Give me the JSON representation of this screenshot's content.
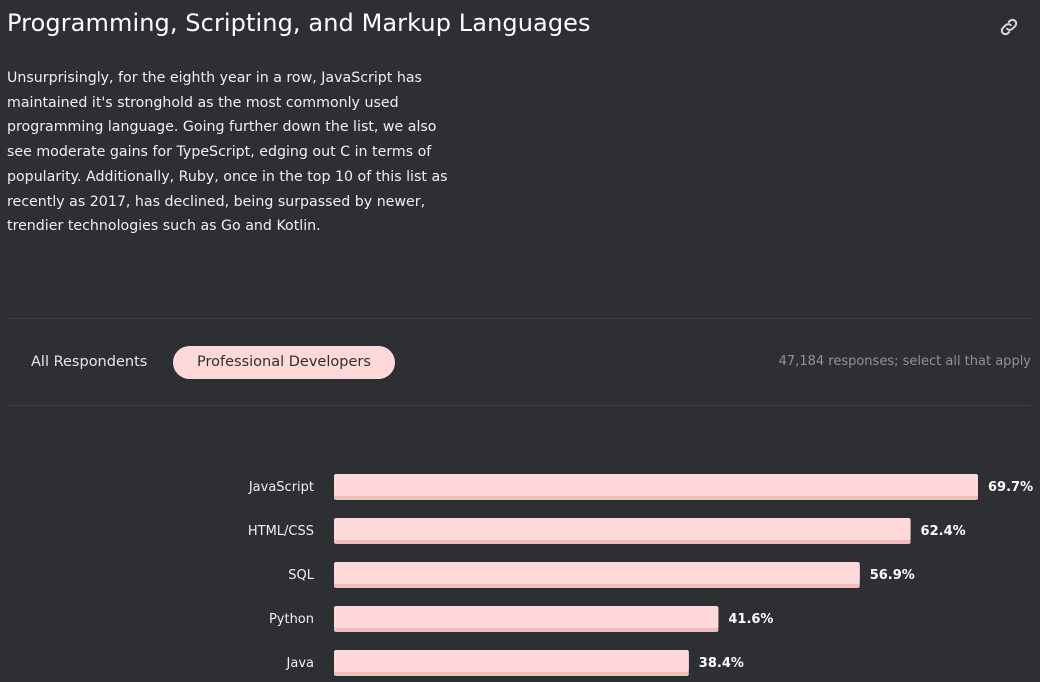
{
  "header": {
    "title": "Programming, Scripting, and Markup Languages",
    "link_icon": "link-icon"
  },
  "intro": "Unsurprisingly, for the eighth year in a row, JavaScript has maintained it's stronghold as the most commonly used programming language. Going further down the list, we also see moderate gains for TypeScript, edging out C in terms of popularity. Additionally, Ruby, once in the top 10 of this list as recently as 2017, has declined, being surpassed by newer, trendier technologies such as Go and Kotlin.",
  "tabs": [
    {
      "label": "All Respondents",
      "active": false
    },
    {
      "label": "Professional Developers",
      "active": true
    }
  ],
  "responses_note": "47,184 responses; select all that apply",
  "colors": {
    "background": "#2d2f33",
    "bar": "#ffd9d9",
    "bar_shadow": "#f3bcbc",
    "active_tab": "#ffd9d9"
  },
  "chart_data": {
    "type": "bar",
    "orientation": "horizontal",
    "categories": [
      "JavaScript",
      "HTML/CSS",
      "SQL",
      "Python",
      "Java"
    ],
    "values": [
      69.7,
      62.4,
      56.9,
      41.6,
      38.4
    ],
    "value_labels": [
      "69.7%",
      "62.4%",
      "56.9%",
      "41.6%",
      "38.4%"
    ],
    "unit": "%",
    "xlim": [
      0,
      69.7
    ]
  }
}
